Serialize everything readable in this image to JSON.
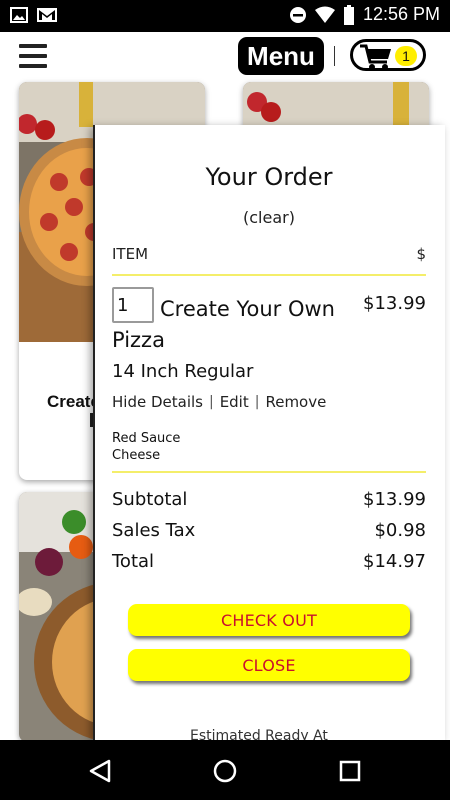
{
  "status_bar": {
    "time": "12:56 PM",
    "icons": [
      "image-icon",
      "gmail-icon",
      "do-not-disturb-icon",
      "wifi-icon",
      "battery-icon"
    ]
  },
  "header": {
    "menu_label": "Menu",
    "cart_count": "1",
    "icons": [
      "hamburger-menu-icon",
      "shopping-cart-icon"
    ]
  },
  "background_cards": {
    "card1_title": "Create"
  },
  "order_panel": {
    "title": "Your Order",
    "clear_label": "(clear)",
    "column_item": "ITEM",
    "column_price": "$",
    "item": {
      "quantity": "1",
      "name_line1": "Create Your Own",
      "name_line2": "Pizza",
      "price": "$13.99",
      "size": "14 Inch Regular",
      "actions": [
        "Hide Details",
        "Edit",
        "Remove"
      ],
      "separator": "|",
      "toppings": [
        "Red Sauce",
        "Cheese"
      ]
    },
    "summary": {
      "subtotal_label": "Subtotal",
      "subtotal_value": "$13.99",
      "tax_label": "Sales Tax",
      "tax_value": "$0.98",
      "total_label": "Total",
      "total_value": "$14.97"
    },
    "checkout_label": "CHECK OUT",
    "close_label": "CLOSE",
    "footer_partial": "Estimated Ready At"
  },
  "nav_bar": {
    "icons": [
      "back-icon",
      "home-icon",
      "recents-icon"
    ]
  },
  "colors": {
    "accent_yellow": "#ffff00",
    "button_text_red": "#c8102e",
    "divider_yellow": "#f4ee6a",
    "badge_yellow": "#ffee00"
  }
}
